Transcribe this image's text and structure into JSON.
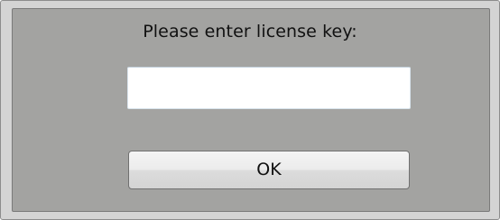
{
  "dialog": {
    "prompt": "Please enter license key:",
    "license_key": {
      "value": "",
      "placeholder": ""
    },
    "ok_label": "OK"
  }
}
